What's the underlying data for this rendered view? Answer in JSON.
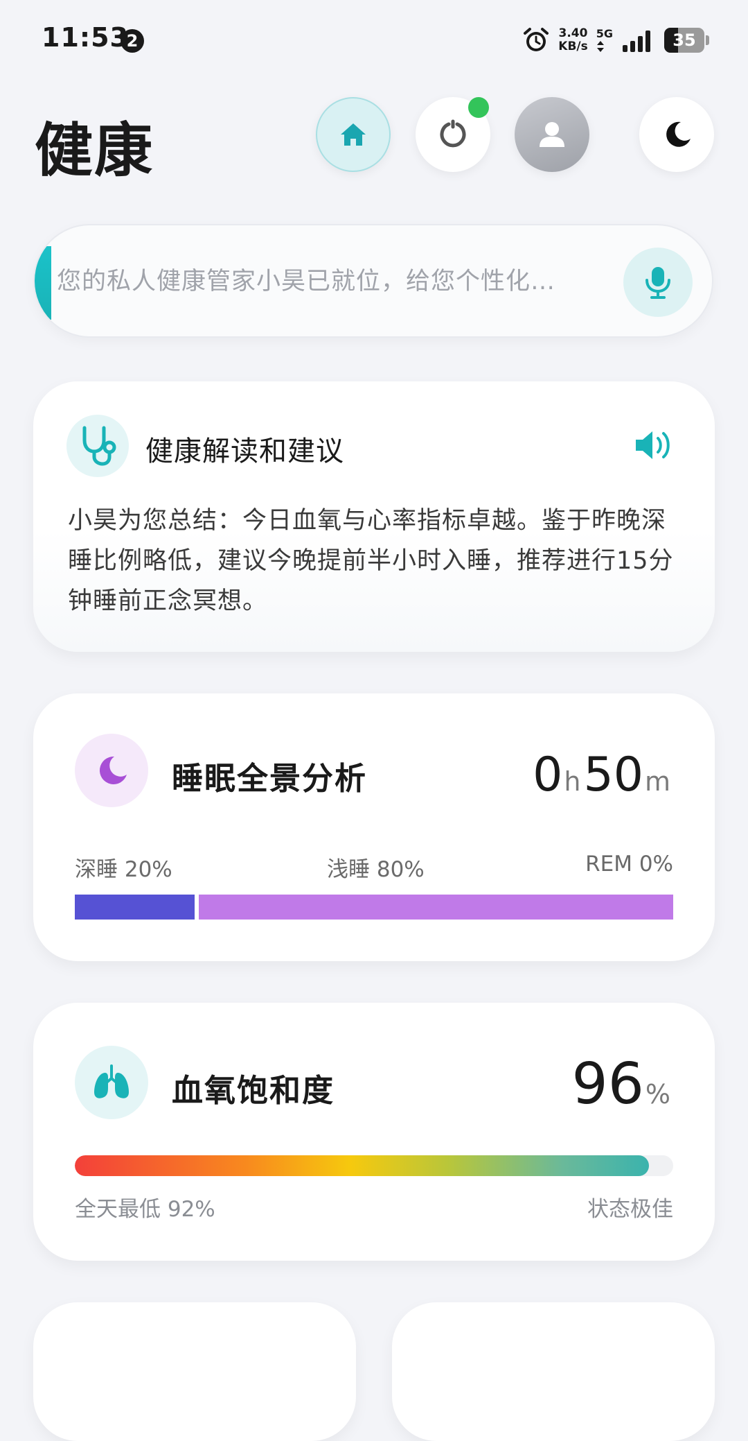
{
  "status_bar": {
    "time": "11:53",
    "notification_count": "2",
    "net_speed_value": "3.40",
    "net_speed_unit": "KB/s",
    "network_type": "5G",
    "battery_level": "35"
  },
  "header": {
    "title": "健康"
  },
  "assistant": {
    "placeholder": "您的私人健康管家小昊已就位，给您个性化…"
  },
  "advice_card": {
    "title": "健康解读和建议",
    "body": "小昊为您总结：今日血氧与心率指标卓越。鉴于昨晚深睡比例略低，建议今晚提前半小时入睡，推荐进行15分钟睡前正念冥想。"
  },
  "sleep_card": {
    "title": "睡眠全景分析",
    "hours": "0",
    "hours_unit": "h",
    "minutes": "50",
    "minutes_unit": "m",
    "deep_label": "深睡 20%",
    "light_label": "浅睡 80%",
    "rem_label": "REM 0%",
    "deep_pct": 20,
    "light_pct": 80,
    "rem_pct": 0,
    "deep_color": "#5652d4",
    "light_color": "#c07ae8"
  },
  "spo2_card": {
    "title": "血氧饱和度",
    "value": "96",
    "unit": "%",
    "fill_pct": 96,
    "min_label": "全天最低 92%",
    "status": "状态极佳"
  },
  "colors": {
    "accent_teal": "#19b3b7",
    "background": "#f3f4f8",
    "status_green": "#33c45a"
  }
}
